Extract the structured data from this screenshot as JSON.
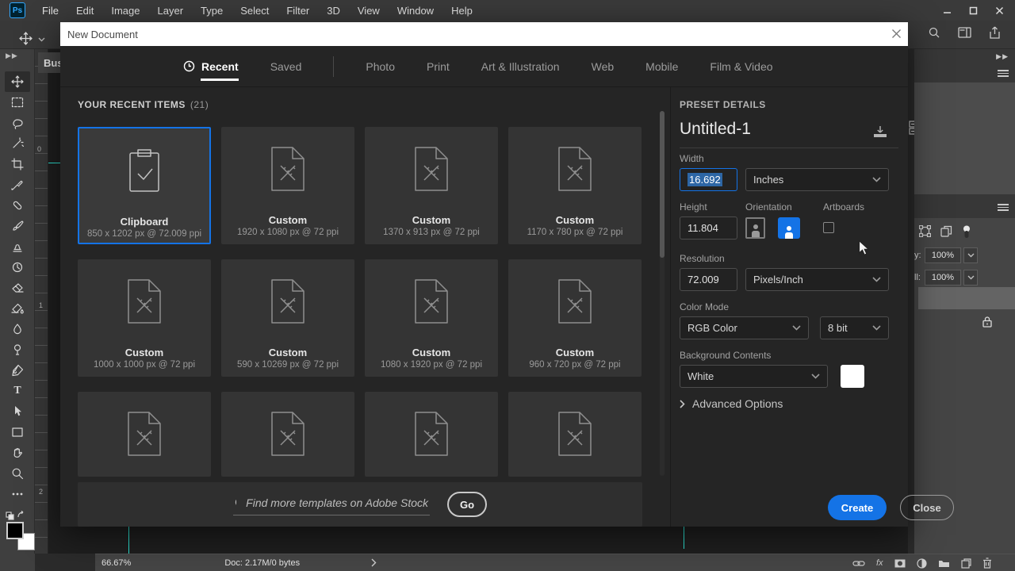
{
  "app": {
    "menu_bar": {
      "logo": "Ps",
      "items": [
        "File",
        "Edit",
        "Image",
        "Layer",
        "Type",
        "Select",
        "Filter",
        "3D",
        "View",
        "Window",
        "Help"
      ]
    },
    "document_tab": "Busi",
    "ruler_ticks": [
      "0",
      "1",
      "2"
    ],
    "layers_panel": {
      "opacity_label": "y:",
      "opacity_value": "100%",
      "fill_label": "ll:",
      "fill_value": "100%"
    },
    "status_bar": {
      "zoom_level": "66.67%",
      "doc_info": "Doc: 2.17M/0 bytes"
    }
  },
  "dialog": {
    "title": "New Document",
    "tabs": [
      {
        "label": "Recent"
      },
      {
        "label": "Saved"
      },
      {
        "label": "Photo"
      },
      {
        "label": "Print"
      },
      {
        "label": "Art & Illustration"
      },
      {
        "label": "Web"
      },
      {
        "label": "Mobile"
      },
      {
        "label": "Film & Video"
      }
    ],
    "active_tab": "Recent",
    "recent_heading": "YOUR RECENT ITEMS",
    "recent_count": "(21)",
    "items": [
      {
        "name": "Clipboard",
        "dims": "850 x 1202 px @ 72.009 ppi",
        "icon": "clipboard",
        "selected": true
      },
      {
        "name": "Custom",
        "dims": "1920 x 1080 px @ 72 ppi",
        "icon": "custom-document"
      },
      {
        "name": "Custom",
        "dims": "1370 x 913 px @ 72 ppi",
        "icon": "custom-document"
      },
      {
        "name": "Custom",
        "dims": "1170 x 780 px @ 72 ppi",
        "icon": "custom-document"
      },
      {
        "name": "Custom",
        "dims": "1000 x 1000 px @ 72 ppi",
        "icon": "custom-document"
      },
      {
        "name": "Custom",
        "dims": "590 x 10269 px @ 72 ppi",
        "icon": "custom-document"
      },
      {
        "name": "Custom",
        "dims": "1080 x 1920 px @ 72 ppi",
        "icon": "custom-document"
      },
      {
        "name": "Custom",
        "dims": "960 x 720 px @ 72 ppi",
        "icon": "custom-document"
      }
    ],
    "stock_search": {
      "placeholder": "Find more templates on Adobe Stock",
      "go_label": "Go"
    },
    "preset": {
      "heading": "PRESET DETAILS",
      "doc_name": "Untitled-1",
      "width_label": "Width",
      "width_value": "16.692",
      "unit": "Inches",
      "height_label": "Height",
      "height_value": "11.804",
      "orientation_label": "Orientation",
      "artboards_label": "Artboards",
      "resolution_label": "Resolution",
      "resolution_value": "72.009",
      "resolution_unit": "Pixels/Inch",
      "color_mode_label": "Color Mode",
      "color_mode": "RGB Color",
      "bit_depth": "8 bit",
      "background_label": "Background Contents",
      "background_value": "White",
      "advanced_label": "Advanced Options",
      "create_label": "Create",
      "close_label": "Close"
    }
  },
  "colors": {
    "accent": "#1473e6",
    "guide": "#2ee8d8",
    "selection_highlight": "#2d66a5"
  }
}
